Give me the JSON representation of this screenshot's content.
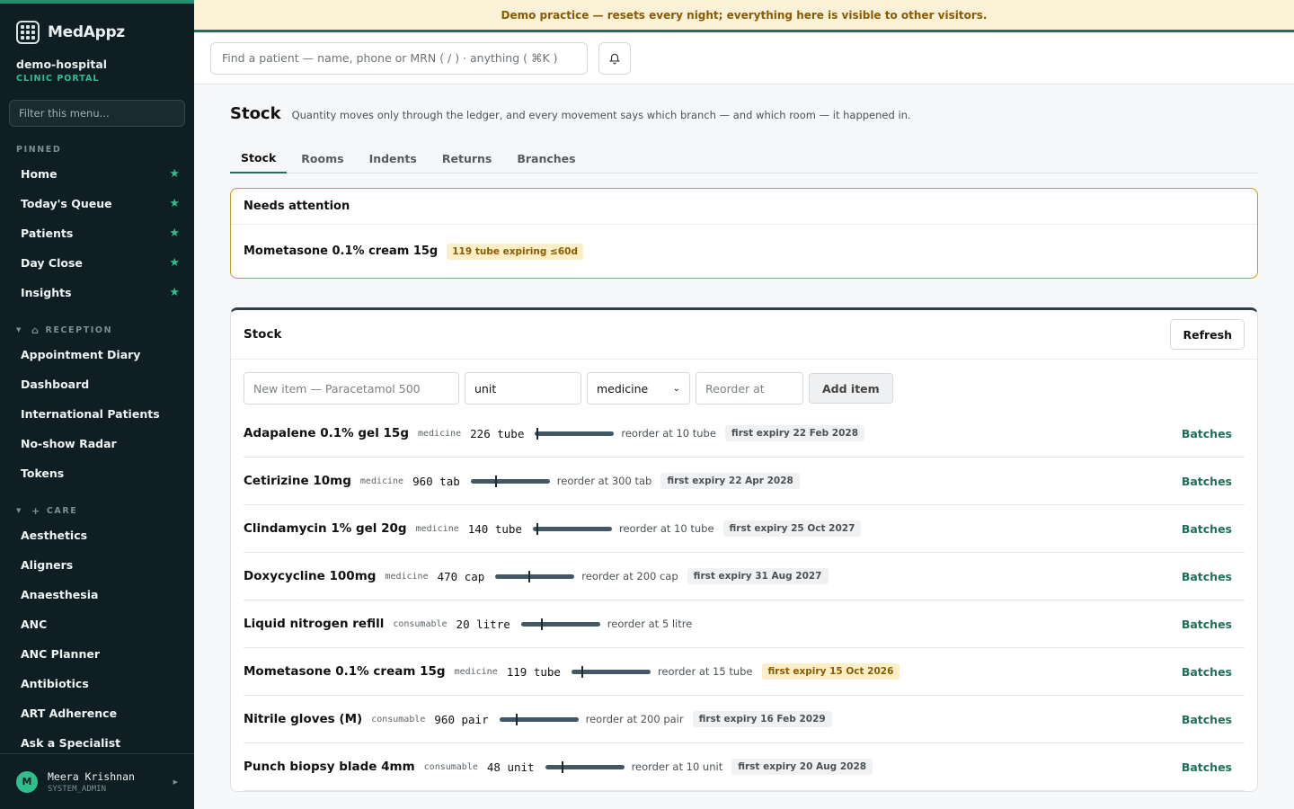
{
  "brand": {
    "name": "MedAppz"
  },
  "org": {
    "name": "demo-hospital",
    "subtitle": "CLINIC PORTAL"
  },
  "sidebar": {
    "filter_placeholder": "Filter this menu...",
    "pinned_label": "PINNED",
    "pinned": [
      {
        "label": "Home"
      },
      {
        "label": "Today's Queue"
      },
      {
        "label": "Patients"
      },
      {
        "label": "Day Close"
      },
      {
        "label": "Insights"
      }
    ],
    "reception_label": "RECEPTION",
    "reception": [
      {
        "label": "Appointment Diary"
      },
      {
        "label": "Dashboard"
      },
      {
        "label": "International Patients"
      },
      {
        "label": "No-show Radar"
      },
      {
        "label": "Tokens"
      }
    ],
    "care_label": "CARE",
    "care": [
      {
        "label": "Aesthetics"
      },
      {
        "label": "Aligners"
      },
      {
        "label": "Anaesthesia"
      },
      {
        "label": "ANC"
      },
      {
        "label": "ANC Planner"
      },
      {
        "label": "Antibiotics"
      },
      {
        "label": "ART Adherence"
      },
      {
        "label": "Ask a Specialist"
      }
    ]
  },
  "user": {
    "initial": "M",
    "name": "Meera Krishnan",
    "role": "SYSTEM_ADMIN"
  },
  "banner": {
    "text": "Demo practice — resets every night; everything here is visible to other visitors."
  },
  "search": {
    "placeholder": "Find a patient — name, phone or MRN ( / ) · anything ( ⌘K )"
  },
  "page": {
    "title": "Stock",
    "description": "Quantity moves only through the ledger, and every movement says which branch — and which room — it happened in."
  },
  "tabs": [
    {
      "label": "Stock",
      "active": true
    },
    {
      "label": "Rooms"
    },
    {
      "label": "Indents"
    },
    {
      "label": "Returns"
    },
    {
      "label": "Branches"
    }
  ],
  "attention": {
    "title": "Needs attention",
    "items": [
      {
        "name": "Mometasone 0.1% cream 15g",
        "badge": "119 tube expiring ≤60d"
      }
    ]
  },
  "stock": {
    "title": "Stock",
    "refresh_label": "Refresh",
    "form": {
      "name_placeholder": "New item — Paracetamol 500",
      "unit_value": "unit",
      "category_value": "medicine",
      "reorder_placeholder": "Reorder at",
      "add_label": "Add item"
    },
    "batches_label": "Batches",
    "items": [
      {
        "name": "Adapalene 0.1% gel 15g",
        "category": "medicine",
        "qty": "226 tube",
        "reorder": "reorder at 10 tube",
        "expiry": "first expiry 22 Feb 2028",
        "reorder_fraction": 0.02
      },
      {
        "name": "Cetirizine 10mg",
        "category": "medicine",
        "qty": "960 tab",
        "reorder": "reorder at 300 tab",
        "expiry": "first expiry 22 Apr 2028",
        "reorder_fraction": 0.31
      },
      {
        "name": "Clindamycin 1% gel 20g",
        "category": "medicine",
        "qty": "140 tube",
        "reorder": "reorder at 10 tube",
        "expiry": "first expiry 25 Oct 2027",
        "reorder_fraction": 0.04
      },
      {
        "name": "Doxycycline 100mg",
        "category": "medicine",
        "qty": "470 cap",
        "reorder": "reorder at 200 cap",
        "expiry": "first expiry 31 Aug 2027",
        "reorder_fraction": 0.42
      },
      {
        "name": "Liquid nitrogen refill",
        "category": "consumable",
        "qty": "20 litre",
        "reorder": "reorder at 5 litre",
        "expiry": "",
        "reorder_fraction": 0.25
      },
      {
        "name": "Mometasone 0.1% cream 15g",
        "category": "medicine",
        "qty": "119 tube",
        "reorder": "reorder at 15 tube",
        "expiry": "first expiry 15 Oct 2026",
        "expiry_warn": true,
        "reorder_fraction": 0.12
      },
      {
        "name": "Nitrile gloves (M)",
        "category": "consumable",
        "qty": "960 pair",
        "reorder": "reorder at 200 pair",
        "expiry": "first expiry 16 Feb 2029",
        "reorder_fraction": 0.21
      },
      {
        "name": "Punch biopsy blade 4mm",
        "category": "consumable",
        "qty": "48 unit",
        "reorder": "reorder at 10 unit",
        "expiry": "first expiry 20 Aug 2028",
        "reorder_fraction": 0.21
      }
    ]
  },
  "colors": {
    "accent": "#1f6f5b",
    "sidebar_bg": "#0f1e22",
    "star": "#2fbf8f",
    "warn_bg": "#fcefc7",
    "warn_text": "#8a5b00"
  }
}
